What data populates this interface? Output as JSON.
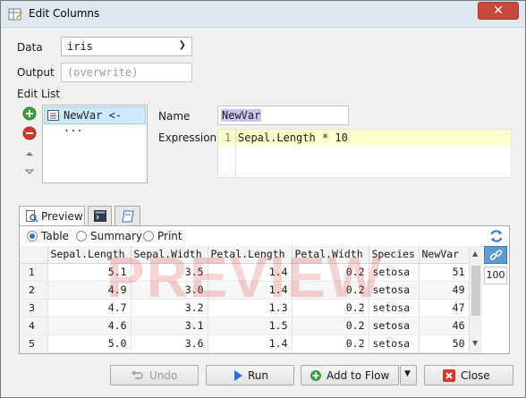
{
  "window": {
    "title": "Edit Columns"
  },
  "form": {
    "data_label": "Data",
    "data_value": "iris",
    "output_label": "Output",
    "output_placeholder": "(overwrite)",
    "edit_list_label": "Edit List",
    "edit_list_items": [
      "NewVar <- ..."
    ],
    "name_label": "Name",
    "name_value": "NewVar",
    "expression_label": "Expression",
    "expression_line_number": "1",
    "expression_value": "Sepal.Length * 10"
  },
  "preview": {
    "tabs": [
      {
        "label": "Preview",
        "icon": "preview-magnifier-icon"
      },
      {
        "label": "",
        "icon": "console-icon"
      },
      {
        "label": "",
        "icon": "document-icon"
      }
    ],
    "view_options": [
      "Table",
      "Summary",
      "Print"
    ],
    "selected_view": "Table",
    "watermark": "PREVIEW",
    "row_count": "100",
    "columns": [
      "",
      "Sepal.Length",
      "Sepal.Width",
      "Petal.Length",
      "Petal.Width",
      "Species",
      "NewVar"
    ],
    "rows": [
      [
        "1",
        "5.1",
        "3.5",
        "1.4",
        "0.2",
        "setosa",
        "51"
      ],
      [
        "2",
        "4.9",
        "3.0",
        "1.4",
        "0.2",
        "setosa",
        "49"
      ],
      [
        "3",
        "4.7",
        "3.2",
        "1.3",
        "0.2",
        "setosa",
        "47"
      ],
      [
        "4",
        "4.6",
        "3.1",
        "1.5",
        "0.2",
        "setosa",
        "46"
      ],
      [
        "5",
        "5.0",
        "3.6",
        "1.4",
        "0.2",
        "setosa",
        "50"
      ]
    ]
  },
  "buttons": {
    "undo": "Undo",
    "run": "Run",
    "add_to_flow": "Add to Flow",
    "close": "Close"
  },
  "colors": {
    "accent_blue": "#2b6fd0",
    "add_green": "#3aa13a",
    "remove_red": "#d23a2a",
    "close_red": "#c9483c"
  }
}
